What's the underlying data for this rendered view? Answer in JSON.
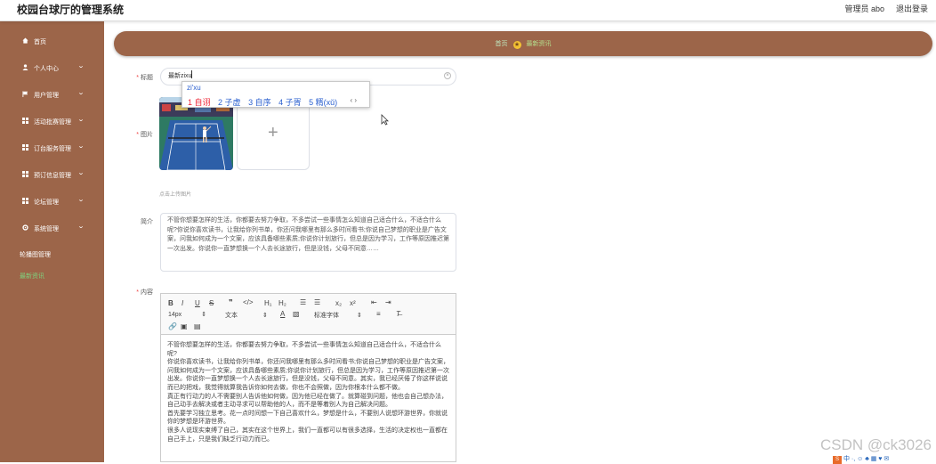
{
  "header": {
    "title": "校园台球厅的管理系统",
    "user": "管理员 abo",
    "logout": "退出登录"
  },
  "sidebar": {
    "items": [
      {
        "label": "首页",
        "icon": "home-icon",
        "expandable": false
      },
      {
        "label": "个人中心",
        "icon": "user-icon",
        "expandable": true
      },
      {
        "label": "用户管理",
        "icon": "flag-icon",
        "expandable": true
      },
      {
        "label": "活动批赛管理",
        "icon": "grid-icon",
        "expandable": true
      },
      {
        "label": "订台服务管理",
        "icon": "grid-icon",
        "expandable": true
      },
      {
        "label": "预订信息管理",
        "icon": "grid-icon",
        "expandable": true
      },
      {
        "label": "论坛管理",
        "icon": "grid-icon",
        "expandable": true
      },
      {
        "label": "系统管理",
        "icon": "gear-icon",
        "expandable": true
      }
    ],
    "subitems": [
      {
        "label": "轮播图管理"
      },
      {
        "label": "最新资讯"
      }
    ]
  },
  "breadcrumb": {
    "home": "首页",
    "current": "最新资讯"
  },
  "form": {
    "title_label": "标题",
    "title_value": "最新zixu",
    "ime": {
      "pinyin": "zi'xu",
      "candidates": [
        "1 自诩",
        "2 子虚",
        "3 自序",
        "4 子胥",
        "5 糈(xǔ)"
      ],
      "nav": "‹ ›"
    },
    "image_label": "图片",
    "upload_tip": "点击上传图片",
    "summary_label": "简介",
    "summary_text": "不管你想要怎样的生活，你都要去努力争取，不多尝试一些事情怎么知道自己适合什么，不适合什么呢?你说你喜欢读书，让我给你列书单，你还问我哪里有那么多时间看书;你说自己梦想的职业是广告文案，问我如何成为一个文案，应该具备哪些素质;你说你计划旅行，但总是因为学习，工作等原因推迟第一次出发。你说你一直梦想换一个人去长途旅行，但是没钱，父母不同意……",
    "content_label": "内容",
    "toolbar": {
      "font_size": "14px",
      "font_type": "文本",
      "font_family": "标准字体"
    },
    "content_text": "不管你想要怎样的生活，你都要去努力争取，不多尝试一些事情怎么知道自己适合什么，不适合什么呢?\n你说你喜欢读书，让我给你列书单，你还问我哪里有那么多时间看书;你说自己梦想的职业是广告文案，问我如何成为一个文案，应该具备哪些素质;你说你计划旅行，但总是因为学习，工作等原因推迟第一次出发。你说你一直梦想换一个人去长途旅行，但是没钱，父母不同意。其实，我已经厌倦了你这样说说而已的把戏，我觉得就算我告诉你如何去做，你也不会照做，因为你根本什么都不做。\n真正有行动力的人不需要别人告诉他如何做，因为他已经在做了。就算碰到问题，他也会自己想办法，自己动手去解决或者主动寻求可以帮助他的人，而不是等着别人为自己解决问题。\n首先要学习独立思考。花一点时间想一下自己喜欢什么，梦想是什么，不要别人说想环游世界，你就说你的梦想是环游世界。\n很多人说现实束缚了自己，其实在这个世界上，我们一直都可以有很多选择，生活的决定权也一直都在自己手上，只是我们缺乏行动力而已。"
  },
  "watermark": "CSDN @ck3026",
  "colors": {
    "sidebar_bg": "#9c6549",
    "active_green": "#7ed27e",
    "ime_blue": "#2a5fcf",
    "required_red": "#e44"
  }
}
